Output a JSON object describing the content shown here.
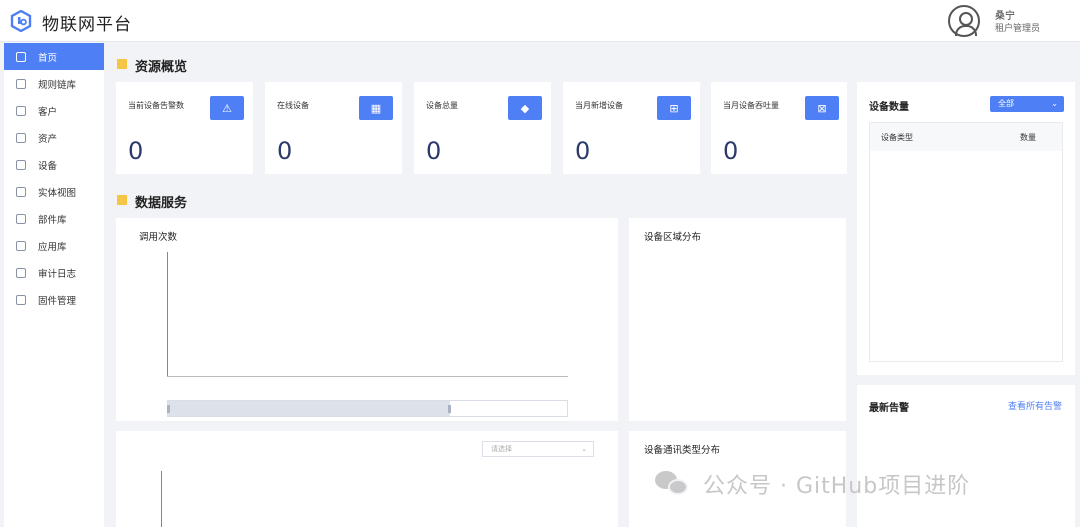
{
  "app": {
    "title": "物联网平台"
  },
  "user": {
    "name": "桑宁",
    "role": "租户管理员"
  },
  "sidebar": {
    "items": [
      {
        "label": "首页",
        "icon": "home-icon",
        "active": true
      },
      {
        "label": "规则链库",
        "icon": "rule-chain-icon"
      },
      {
        "label": "客户",
        "icon": "customer-icon"
      },
      {
        "label": "资产",
        "icon": "asset-icon"
      },
      {
        "label": "设备",
        "icon": "device-icon"
      },
      {
        "label": "实体视图",
        "icon": "entity-view-icon"
      },
      {
        "label": "部件库",
        "icon": "widget-library-icon"
      },
      {
        "label": "应用库",
        "icon": "app-library-icon"
      },
      {
        "label": "审计日志",
        "icon": "audit-log-icon"
      },
      {
        "label": "固件管理",
        "icon": "firmware-icon"
      }
    ]
  },
  "overview": {
    "title": "资源概览",
    "cards": [
      {
        "label": "当前设备告警数",
        "value": "0",
        "icon": "alarm-icon"
      },
      {
        "label": "在线设备",
        "value": "0",
        "icon": "online-device-icon"
      },
      {
        "label": "设备总量",
        "value": "0",
        "icon": "cube-icon"
      },
      {
        "label": "当月新增设备",
        "value": "0",
        "icon": "add-device-icon"
      },
      {
        "label": "当月设备吞吐量",
        "value": "0",
        "icon": "throughput-icon"
      }
    ]
  },
  "data_service": {
    "title": "数据服务",
    "call_count_title": "调用次数",
    "region_title": "设备区域分布",
    "comm_type_title": "设备通讯类型分布",
    "select_placeholder": "请选择"
  },
  "device_count": {
    "title": "设备数量",
    "filter": "全部",
    "columns": [
      "设备类型",
      "数量"
    ]
  },
  "alarms": {
    "title": "最新告警",
    "view_all": "查看所有告警"
  },
  "watermark": {
    "text": "公众号 · GitHub项目进阶"
  },
  "colors": {
    "accent": "#4f7ff5",
    "section_mark": "#f7c544",
    "background": "#f2f3f7"
  }
}
